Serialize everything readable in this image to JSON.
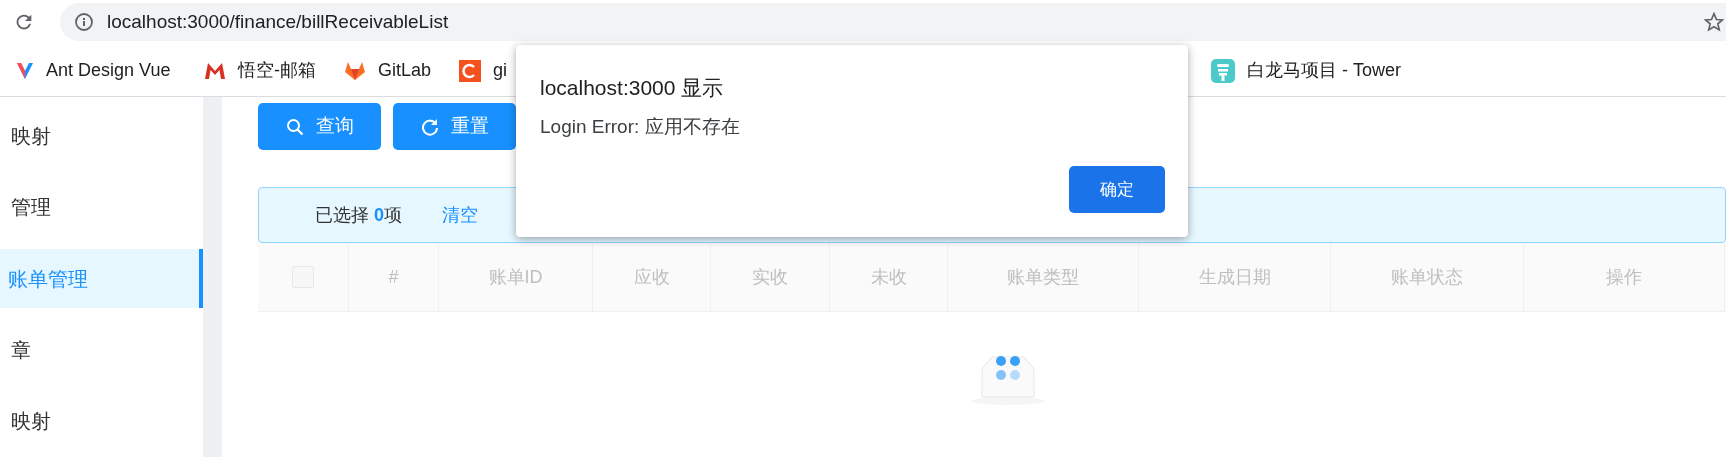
{
  "browser": {
    "url": "localhost:3000/finance/billReceivableList",
    "bookmarks": [
      {
        "label": "Ant Design Vue",
        "kind": "antd"
      },
      {
        "label": "悟空-邮箱",
        "kind": "mail"
      },
      {
        "label": "GitLab",
        "kind": "gitlab"
      },
      {
        "label": "gi",
        "kind": "c"
      },
      {
        "label": "白龙马项目 - Tower",
        "kind": "tower"
      }
    ]
  },
  "sidebar": {
    "items": [
      {
        "label": "映射",
        "selected": false
      },
      {
        "label": "管理",
        "selected": false
      },
      {
        "label": "账单管理",
        "selected": true
      },
      {
        "label": "章",
        "selected": false
      },
      {
        "label": "映射",
        "selected": false
      }
    ]
  },
  "toolbar": {
    "buttons": [
      {
        "label": "查询",
        "kind": "search"
      },
      {
        "label": "重置",
        "kind": "reload"
      }
    ]
  },
  "selection": {
    "prefix": "已选择",
    "count": "0",
    "suffix": "项",
    "clear": "清空"
  },
  "table": {
    "select_all_checked": false,
    "columns": [
      "#",
      "账单ID",
      "应收",
      "实收",
      "未收",
      "账单类型",
      "生成日期",
      "账单状态",
      "操作"
    ]
  },
  "dialog": {
    "title": "localhost:3000 显示",
    "message": "Login Error: 应用不存在",
    "ok": "确定"
  }
}
